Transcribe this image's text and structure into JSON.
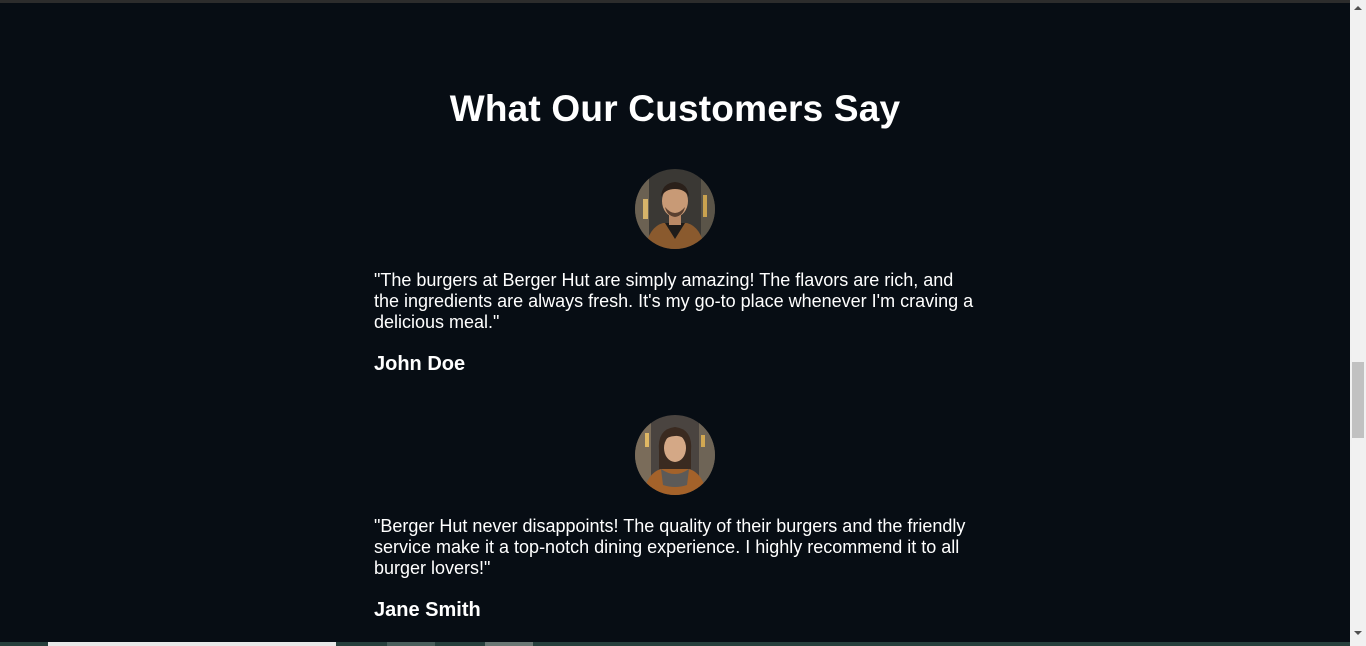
{
  "testimonials_section": {
    "title": "What Our Customers Say",
    "items": [
      {
        "quote": "\"The burgers at Berger Hut are simply amazing! The flavors are rich, and the ingredients are always fresh. It's my go-to place whenever I'm craving a delicious meal.\"",
        "author": "John Doe"
      },
      {
        "quote": "\"Berger Hut never disappoints! The quality of their burgers and the friendly service make it a top-notch dining experience. I highly recommend it to all burger lovers!\"",
        "author": "Jane Smith"
      }
    ]
  },
  "colors": {
    "background": "#070d14",
    "text": "#ffffff"
  }
}
